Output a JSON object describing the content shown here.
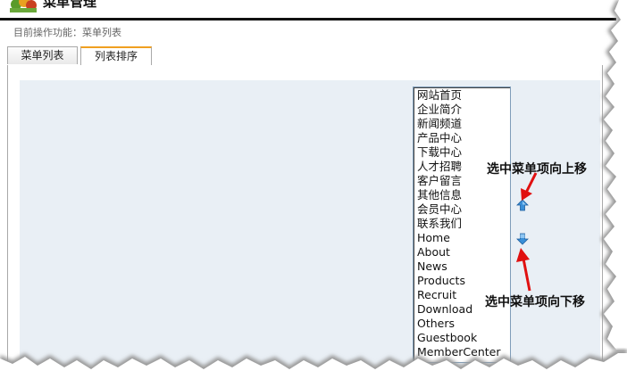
{
  "header": {
    "title": "菜单管理"
  },
  "breadcrumb": {
    "text": "目前操作功能：菜单列表"
  },
  "tabs": [
    {
      "label": "菜单列表",
      "active": false
    },
    {
      "label": "列表排序",
      "active": true
    }
  ],
  "menu_list": {
    "items": [
      "网站首页",
      "企业简介",
      "新闻频道",
      "产品中心",
      "下载中心",
      "人才招聘",
      "客户留言",
      "其他信息",
      "会员中心",
      "联系我们",
      "Home",
      "About",
      "News",
      "Products",
      "Recruit",
      "Download",
      "Others",
      "Guestbook",
      "MemberCenter"
    ]
  },
  "controls": {
    "move_up_icon": "arrow-up-icon",
    "move_down_icon": "arrow-down-icon"
  },
  "annotations": {
    "move_up": "选中菜单项向上移",
    "move_down": "选中菜单项向下移"
  },
  "colors": {
    "panel_bg": "#e9eff5",
    "active_tab_accent": "#f0a020",
    "arrow_blue": "#3a8fd8",
    "annotation_arrow": "#e01010"
  }
}
